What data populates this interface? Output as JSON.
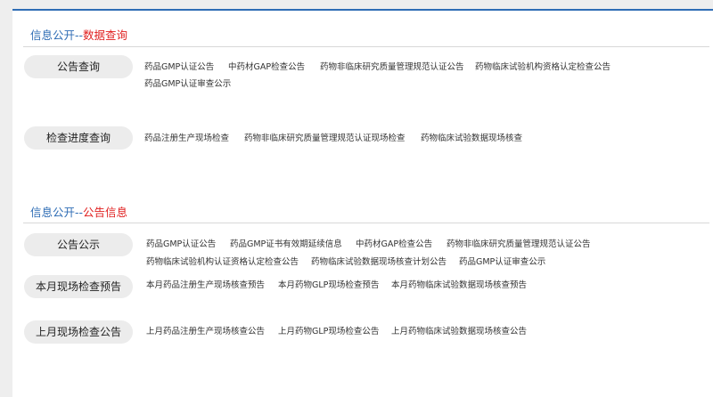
{
  "section1": {
    "title_prefix": "信息公开",
    "title_sep": "--",
    "title_highlight": "数据查询",
    "categories": [
      {
        "label": "公告查询",
        "links": [
          "药品GMP认证公告",
          "中药材GAP检查公告",
          "药物非临床研究质量管理规范认证公告",
          "药物临床试验机构资格认定检查公告",
          "药品GMP认证审查公示"
        ]
      },
      {
        "label": "检查进度查询",
        "links": [
          "药品注册生产现场检查",
          "药物非临床研究质量管理规范认证现场检查",
          "药物临床试验数据现场核查"
        ]
      }
    ]
  },
  "section2": {
    "title_prefix": "信息公开",
    "title_sep": "--",
    "title_highlight": "公告信息",
    "categories": [
      {
        "label": "公告公示",
        "links": [
          "药品GMP认证公告",
          "药品GMP证书有效期延续信息",
          "中药材GAP检查公告",
          "药物非临床研究质量管理规范认证公告",
          "药物临床试验机构认证资格认定检查公告",
          "药物临床试验数据现场核查计划公告",
          "药品GMP认证审查公示"
        ]
      },
      {
        "label": "本月现场检查预告",
        "links": [
          "本月药品注册生产现场核查预告",
          "本月药物GLP现场检查预告",
          "本月药物临床试验数据现场核查预告"
        ]
      },
      {
        "label": "上月现场检查公告",
        "links": [
          "上月药品注册生产现场核查公告",
          "上月药物GLP现场检查公告",
          "上月药物临床试验数据现场核查公告"
        ]
      }
    ]
  }
}
